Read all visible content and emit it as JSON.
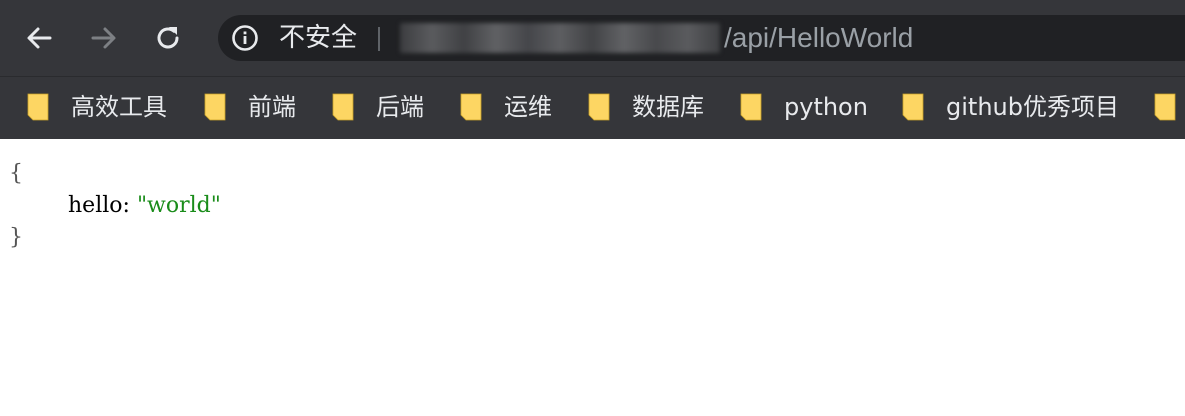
{
  "browser": {
    "security_label": "不安全",
    "url_path": "/api/HelloWorld"
  },
  "bookmarks": [
    {
      "label": "高效工具"
    },
    {
      "label": "前端"
    },
    {
      "label": "后端"
    },
    {
      "label": "运维"
    },
    {
      "label": "数据库"
    },
    {
      "label": "python"
    },
    {
      "label": "github优秀项目"
    },
    {
      "label": ""
    }
  ],
  "json_view": {
    "open_brace": "{",
    "key": "hello",
    "colon": ":",
    "value": "\"world\"",
    "close_brace": "}"
  },
  "colors": {
    "folder_icon": "#fdd663",
    "string_value": "#1a8c1a"
  }
}
